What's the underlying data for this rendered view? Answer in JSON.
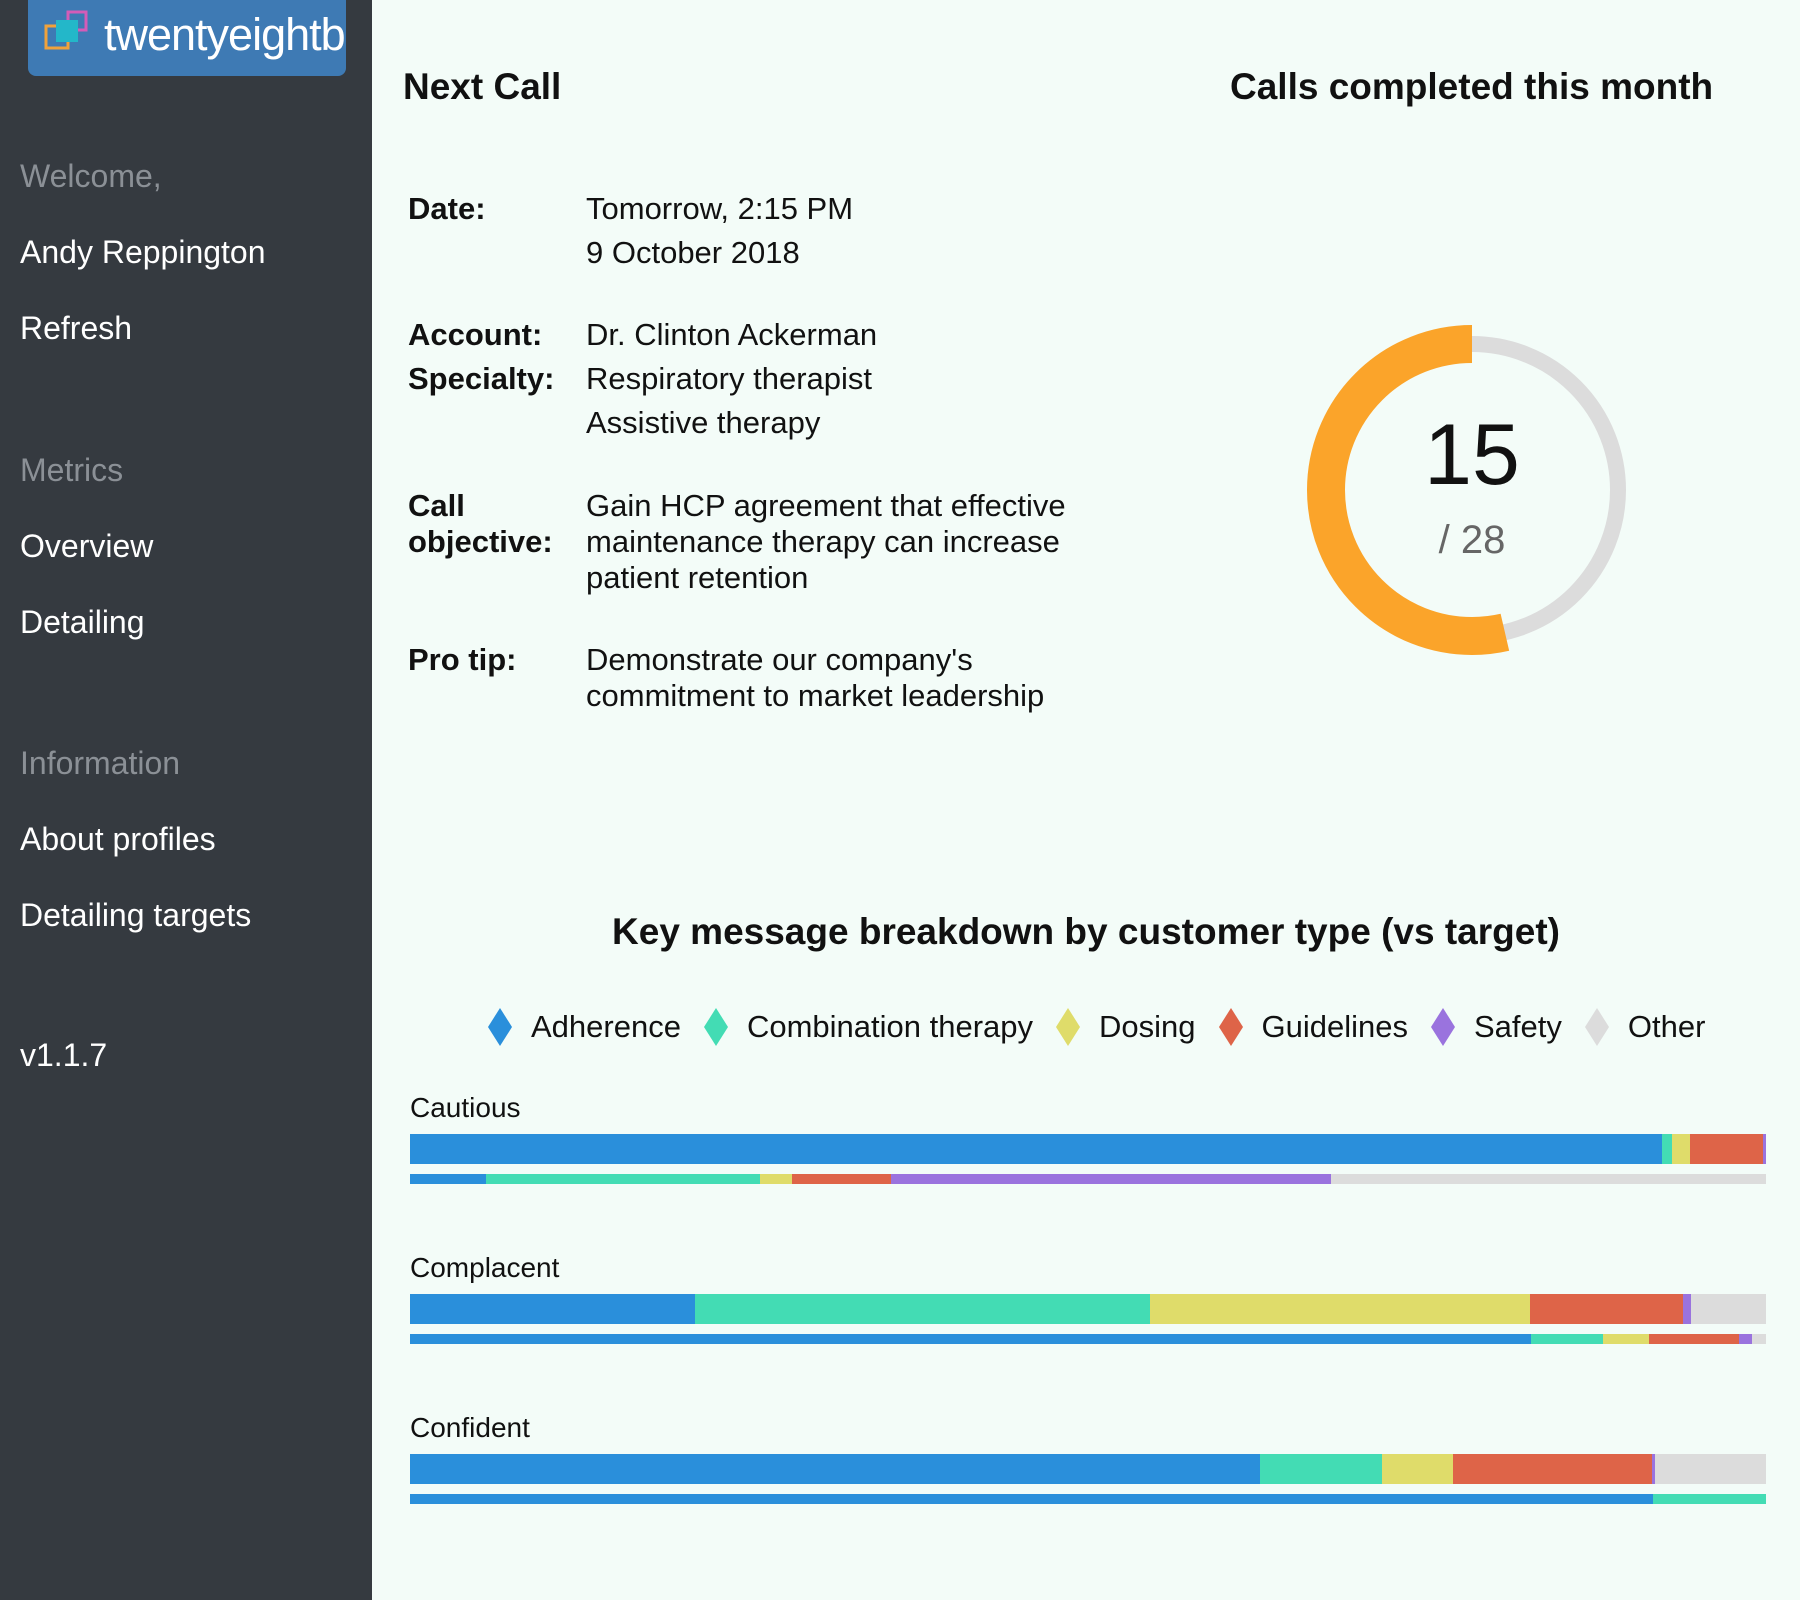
{
  "sidebar": {
    "logo_text": "twentyeightb",
    "welcome": "Welcome,",
    "user": "Andy Reppington",
    "refresh": "Refresh",
    "metrics_label": "Metrics",
    "overview": "Overview",
    "detailing": "Detailing",
    "information_label": "Information",
    "about_profiles": "About profiles",
    "detailing_targets": "Detailing targets",
    "version": "v1.1.7"
  },
  "next_call": {
    "title": "Next Call",
    "date_label": "Date:",
    "date_line1": "Tomorrow, 2:15 PM",
    "date_line2": "9 October 2018",
    "account_label": "Account:",
    "account": "Dr. Clinton Ackerman",
    "specialty_label": "Specialty:",
    "specialty_line1": "Respiratory therapist",
    "specialty_line2": "Assistive therapy",
    "objective_label_1": "Call",
    "objective_label_2": "objective:",
    "objective": "Gain HCP agreement that effective maintenance therapy can increase patient retention",
    "tip_label": "Pro tip:",
    "tip": "Demonstrate our company's commitment to market leadership"
  },
  "calls": {
    "title": "Calls completed this month",
    "completed": "15",
    "total_label": "/ 28",
    "progress_fraction": 0.536,
    "accent_color": "#fba42a",
    "track_color": "#dcdcdc"
  },
  "chart_data": {
    "type": "bar",
    "orientation": "horizontal-stacked",
    "title": "Key message breakdown by customer type (vs target)",
    "categories": [
      "Adherence",
      "Combination therapy",
      "Dosing",
      "Guidelines",
      "Safety",
      "Other"
    ],
    "colors": [
      "#2a8fdb",
      "#43dcb4",
      "#dfdc6a",
      "#de6448",
      "#9a73de",
      "#dcdcdc"
    ],
    "rows": [
      {
        "name": "Cautious",
        "actual": [
          92.3,
          0.8,
          1.3,
          5.4,
          0.2,
          0.0
        ],
        "target": [
          5.6,
          20.2,
          2.4,
          7.3,
          32.4,
          32.1
        ]
      },
      {
        "name": "Complacent",
        "actual": [
          21.0,
          33.6,
          28.0,
          11.3,
          0.6,
          5.5
        ],
        "target": [
          82.7,
          5.3,
          3.4,
          6.6,
          1.0,
          1.0
        ]
      },
      {
        "name": "Confident",
        "actual": [
          62.7,
          9.0,
          5.2,
          14.7,
          0.2,
          8.2
        ],
        "target": [
          91.7,
          8.3,
          0.0,
          0.0,
          0.0,
          0.0
        ]
      }
    ]
  }
}
